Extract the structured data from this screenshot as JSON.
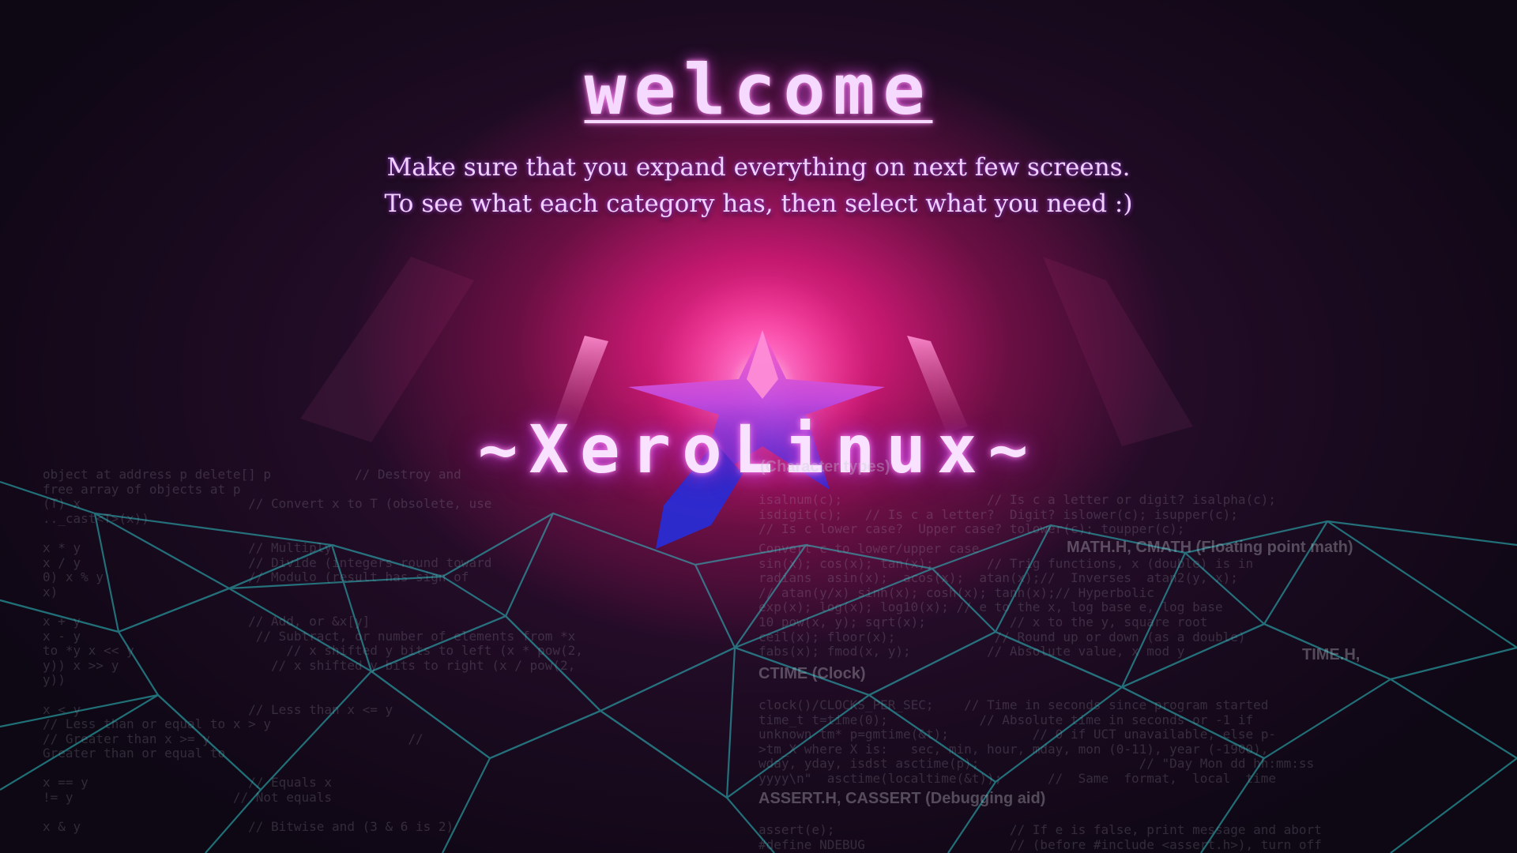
{
  "welcome": {
    "title": "welcome",
    "subtitle_line1": "Make sure that you expand everything on next few screens.",
    "subtitle_line2": "To see what each category has, then select what you need :)"
  },
  "brand": {
    "name": "~XeroLinux~"
  },
  "colors": {
    "glow_magenta": "#ff3f9c",
    "logo_pink": "#ff4fb0",
    "logo_blue": "#2c2bd6",
    "mesh_teal": "#2ec4c6",
    "text_lavender": "#f0d0ff"
  },
  "background_code": {
    "left": "object at address p delete[] p           // Destroy and\nfree array of objects at p\n(T) x                      // Convert x to T (obsolete, use\n.._cast<T>(x))\n\nx * y                      // Multiply\nx / y                      // Divide (integers round toward\n0) x % y                   // Modulo (result has sign of\nx)\n\nx + y                      // Add, or &x[y]\nx - y                       // Subtract, or number of elements from *x\nto *y x << y                    // x shifted y bits to left (x * pow(2,\ny)) x >> y                    // x shifted y bits to right (x / pow(2,\ny))\n\nx < y                      // Less than x <= y\n// Less than or equal to x > y\n// Greater than x >= y                          //\nGreater than or equal to\n\nx == y                     // Equals x\n!= y                     // Not equals\n\nx & y                      // Bitwise and (3 & 6 is 2)",
    "right_top": "isalnum(c);                   // Is c a letter or digit? isalpha(c);\nisdigit(c);   // Is c a letter?  Digit? islower(c); isupper(c);\n// Is c lower case?  Upper case? tolower(c); toupper(c);",
    "right_mid1": "Convert c to lower/upper case\nsin(x); cos(x); tan(x);       // Trig functions, x (double) is in\nradians  asin(x);  acos(x);  atan(x);//  Inverses  atan2(y, x);\n// atan(y/x) sinh(x); cosh(x); tanh(x);// Hyperbolic\nexp(x); log(x); log10(x); // e to the x, log base e, log base\n10 pow(x, y); sqrt(x);           // x to the y, square root\nceil(x); floor(x);             // Round up or down (as a double)\nfabs(x); fmod(x, y);          // Absolute value, x mod y",
    "right_mid2": "clock()/CLOCKS_PER_SEC;    // Time in seconds since program started\ntime_t t=time(0);            // Absolute time in seconds or -1 if\nunknown tm* p=gmtime(&t);           // 0 if UCT unavailable, else p-\n>tm_X where X is:   sec, min, hour, mday, mon (0-11), year (-1900),\nwday, yday, isdst asctime(p);                     // \"Day Mon dd hh:mm:ss\nyyyy\\n\"  asctime(localtime(&t));      //  Same  format,  local  time",
    "right_bottom": "assert(e);                       // If e is false, print message and abort\n#define NDEBUG                   // (before #include <assert.h>), turn off",
    "heading_char": "(Character types)",
    "heading_math": "MATH.H, CMATH (Floating point math)",
    "heading_time1": "TIME.H,",
    "heading_time2": "CTIME (Clock)",
    "heading_assert": "ASSERT.H, CASSERT (Debugging aid)"
  }
}
